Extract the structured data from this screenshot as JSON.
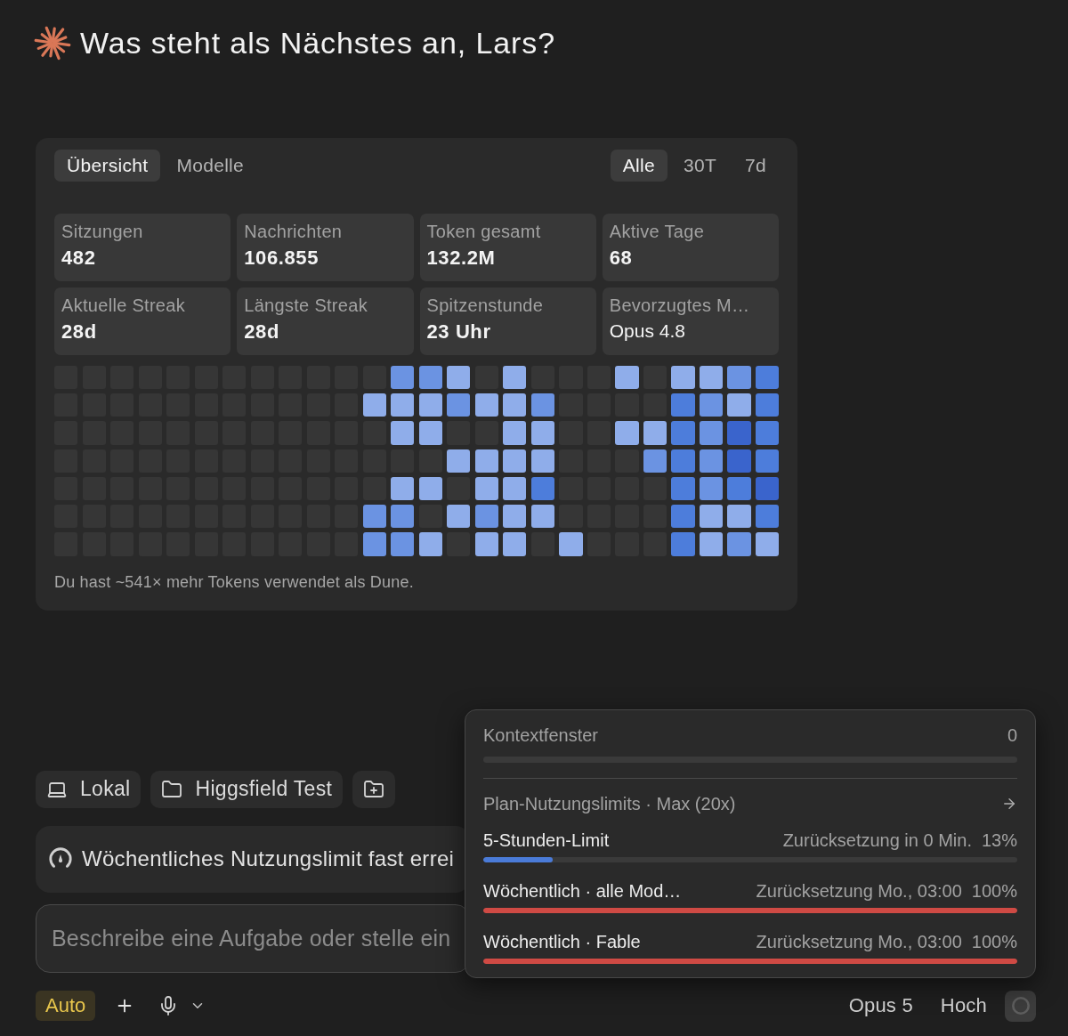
{
  "header": {
    "title": "Was steht als Nächstes an, Lars?"
  },
  "stats_card": {
    "view_tabs": [
      {
        "label": "Übersicht",
        "selected": true
      },
      {
        "label": "Modelle",
        "selected": false
      }
    ],
    "range_tabs": [
      {
        "label": "Alle",
        "selected": true
      },
      {
        "label": "30T",
        "selected": false
      },
      {
        "label": "7d",
        "selected": false
      }
    ],
    "stats": [
      {
        "label": "Sitzungen",
        "value": "482",
        "kind": "number"
      },
      {
        "label": "Nachrichten",
        "value": "106.855",
        "kind": "number"
      },
      {
        "label": "Token gesamt",
        "value": "132.2M",
        "kind": "number"
      },
      {
        "label": "Aktive Tage",
        "value": "68",
        "kind": "number"
      },
      {
        "label": "Aktuelle Streak",
        "value": "28d",
        "kind": "number"
      },
      {
        "label": "Längste Streak",
        "value": "28d",
        "kind": "number"
      },
      {
        "label": "Spitzenstunde",
        "value": "23 Uhr",
        "kind": "number"
      },
      {
        "label": "Bevorzugtes M…",
        "value": "Opus 4.8",
        "kind": "text"
      }
    ],
    "heatmap": {
      "rows": [
        {
          "cells": [
            {
              "color": "#363636"
            },
            {
              "color": "#363636"
            },
            {
              "color": "#363636"
            },
            {
              "color": "#363636"
            },
            {
              "color": "#363636"
            },
            {
              "color": "#363636"
            },
            {
              "color": "#363636"
            },
            {
              "color": "#363636"
            },
            {
              "color": "#363636"
            },
            {
              "color": "#363636"
            },
            {
              "color": "#363636"
            },
            {
              "color": "#363636"
            },
            {
              "color": "#6b93e2"
            },
            {
              "color": "#6b93e2"
            },
            {
              "color": "#8fadea"
            },
            {
              "color": "#363636"
            },
            {
              "color": "#8fadea"
            },
            {
              "color": "#363636"
            },
            {
              "color": "#363636"
            },
            {
              "color": "#363636"
            },
            {
              "color": "#8fadea"
            },
            {
              "color": "#363636"
            },
            {
              "color": "#8fadea"
            },
            {
              "color": "#8fadea"
            },
            {
              "color": "#6b93e2"
            },
            {
              "color": "#4d7ddb"
            }
          ]
        },
        {
          "cells": [
            {
              "color": "#363636"
            },
            {
              "color": "#363636"
            },
            {
              "color": "#363636"
            },
            {
              "color": "#363636"
            },
            {
              "color": "#363636"
            },
            {
              "color": "#363636"
            },
            {
              "color": "#363636"
            },
            {
              "color": "#363636"
            },
            {
              "color": "#363636"
            },
            {
              "color": "#363636"
            },
            {
              "color": "#363636"
            },
            {
              "color": "#8fadea"
            },
            {
              "color": "#8fadea"
            },
            {
              "color": "#8fadea"
            },
            {
              "color": "#6b93e2"
            },
            {
              "color": "#8fadea"
            },
            {
              "color": "#8fadea"
            },
            {
              "color": "#6b93e2"
            },
            {
              "color": "#363636"
            },
            {
              "color": "#363636"
            },
            {
              "color": "#363636"
            },
            {
              "color": "#363636"
            },
            {
              "color": "#4d7ddb"
            },
            {
              "color": "#6b93e2"
            },
            {
              "color": "#8fadea"
            },
            {
              "color": "#4d7ddb"
            }
          ]
        },
        {
          "cells": [
            {
              "color": "#363636"
            },
            {
              "color": "#363636"
            },
            {
              "color": "#363636"
            },
            {
              "color": "#363636"
            },
            {
              "color": "#363636"
            },
            {
              "color": "#363636"
            },
            {
              "color": "#363636"
            },
            {
              "color": "#363636"
            },
            {
              "color": "#363636"
            },
            {
              "color": "#363636"
            },
            {
              "color": "#363636"
            },
            {
              "color": "#363636"
            },
            {
              "color": "#8fadea"
            },
            {
              "color": "#8fadea"
            },
            {
              "color": "#363636"
            },
            {
              "color": "#363636"
            },
            {
              "color": "#8fadea"
            },
            {
              "color": "#8fadea"
            },
            {
              "color": "#363636"
            },
            {
              "color": "#363636"
            },
            {
              "color": "#8fadea"
            },
            {
              "color": "#8fadea"
            },
            {
              "color": "#4d7ddb"
            },
            {
              "color": "#6b93e2"
            },
            {
              "color": "#3a64cc"
            },
            {
              "color": "#4d7ddb"
            }
          ]
        },
        {
          "cells": [
            {
              "color": "#363636"
            },
            {
              "color": "#363636"
            },
            {
              "color": "#363636"
            },
            {
              "color": "#363636"
            },
            {
              "color": "#363636"
            },
            {
              "color": "#363636"
            },
            {
              "color": "#363636"
            },
            {
              "color": "#363636"
            },
            {
              "color": "#363636"
            },
            {
              "color": "#363636"
            },
            {
              "color": "#363636"
            },
            {
              "color": "#363636"
            },
            {
              "color": "#363636"
            },
            {
              "color": "#363636"
            },
            {
              "color": "#8fadea"
            },
            {
              "color": "#8fadea"
            },
            {
              "color": "#8fadea"
            },
            {
              "color": "#8fadea"
            },
            {
              "color": "#363636"
            },
            {
              "color": "#363636"
            },
            {
              "color": "#363636"
            },
            {
              "color": "#6b93e2"
            },
            {
              "color": "#4d7ddb"
            },
            {
              "color": "#6b93e2"
            },
            {
              "color": "#3a64cc"
            },
            {
              "color": "#4d7ddb"
            }
          ]
        },
        {
          "cells": [
            {
              "color": "#363636"
            },
            {
              "color": "#363636"
            },
            {
              "color": "#363636"
            },
            {
              "color": "#363636"
            },
            {
              "color": "#363636"
            },
            {
              "color": "#363636"
            },
            {
              "color": "#363636"
            },
            {
              "color": "#363636"
            },
            {
              "color": "#363636"
            },
            {
              "color": "#363636"
            },
            {
              "color": "#363636"
            },
            {
              "color": "#363636"
            },
            {
              "color": "#8fadea"
            },
            {
              "color": "#8fadea"
            },
            {
              "color": "#363636"
            },
            {
              "color": "#8fadea"
            },
            {
              "color": "#8fadea"
            },
            {
              "color": "#4d7ddb"
            },
            {
              "color": "#363636"
            },
            {
              "color": "#363636"
            },
            {
              "color": "#363636"
            },
            {
              "color": "#363636"
            },
            {
              "color": "#4d7ddb"
            },
            {
              "color": "#6b93e2"
            },
            {
              "color": "#4d7ddb"
            },
            {
              "color": "#3a64cc"
            }
          ]
        },
        {
          "cells": [
            {
              "color": "#363636"
            },
            {
              "color": "#363636"
            },
            {
              "color": "#363636"
            },
            {
              "color": "#363636"
            },
            {
              "color": "#363636"
            },
            {
              "color": "#363636"
            },
            {
              "color": "#363636"
            },
            {
              "color": "#363636"
            },
            {
              "color": "#363636"
            },
            {
              "color": "#363636"
            },
            {
              "color": "#363636"
            },
            {
              "color": "#6b93e2"
            },
            {
              "color": "#6b93e2"
            },
            {
              "color": "#363636"
            },
            {
              "color": "#8fadea"
            },
            {
              "color": "#6b93e2"
            },
            {
              "color": "#8fadea"
            },
            {
              "color": "#8fadea"
            },
            {
              "color": "#363636"
            },
            {
              "color": "#363636"
            },
            {
              "color": "#363636"
            },
            {
              "color": "#363636"
            },
            {
              "color": "#4d7ddb"
            },
            {
              "color": "#8fadea"
            },
            {
              "color": "#8fadea"
            },
            {
              "color": "#4d7ddb"
            }
          ]
        },
        {
          "cells": [
            {
              "color": "#363636"
            },
            {
              "color": "#363636"
            },
            {
              "color": "#363636"
            },
            {
              "color": "#363636"
            },
            {
              "color": "#363636"
            },
            {
              "color": "#363636"
            },
            {
              "color": "#363636"
            },
            {
              "color": "#363636"
            },
            {
              "color": "#363636"
            },
            {
              "color": "#363636"
            },
            {
              "color": "#363636"
            },
            {
              "color": "#6b93e2"
            },
            {
              "color": "#6b93e2"
            },
            {
              "color": "#8fadea"
            },
            {
              "color": "#363636"
            },
            {
              "color": "#8fadea"
            },
            {
              "color": "#8fadea"
            },
            {
              "color": "#363636"
            },
            {
              "color": "#8fadea"
            },
            {
              "color": "#363636"
            },
            {
              "color": "#363636"
            },
            {
              "color": "#363636"
            },
            {
              "color": "#4d7ddb"
            },
            {
              "color": "#8fadea"
            },
            {
              "color": "#6b93e2"
            },
            {
              "color": "#8fadea"
            }
          ]
        }
      ]
    },
    "comparison": "Du hast ~541× mehr Tokens verwendet als Dune."
  },
  "composer": {
    "chips": [
      {
        "kind": "location",
        "label": "Lokal"
      },
      {
        "kind": "folder",
        "label": "Higgsfield Test"
      },
      {
        "kind": "add_folder"
      }
    ],
    "banner": {
      "text": "Wöchentliches Nutzungslimit fast errei"
    },
    "input": {
      "placeholder": "Beschreibe eine Aufgabe oder stelle ein"
    },
    "toolbar": {
      "mode": "Auto",
      "model": "Opus 5",
      "effort": "Hoch"
    }
  },
  "usage_popup": {
    "context": {
      "label": "Kontextfenster",
      "value": "0"
    },
    "plan": {
      "title": "Plan-Nutzungslimits · Max (20x)",
      "limits": [
        {
          "name": "5-Stunden-Limit",
          "reset": "Zurücksetzung in 0 Min.",
          "percent": "13%",
          "level": 0.13,
          "color": "#4a7bd8"
        },
        {
          "name": "Wöchentlich · alle Mod…",
          "reset": "Zurücksetzung Mo., 03:00",
          "percent": "100%",
          "level": 1,
          "color": "#cf4a44"
        },
        {
          "name": "Wöchentlich · Fable",
          "reset": "Zurücksetzung Mo., 03:00",
          "percent": "100%",
          "level": 1,
          "color": "#cf4a44"
        }
      ]
    }
  }
}
